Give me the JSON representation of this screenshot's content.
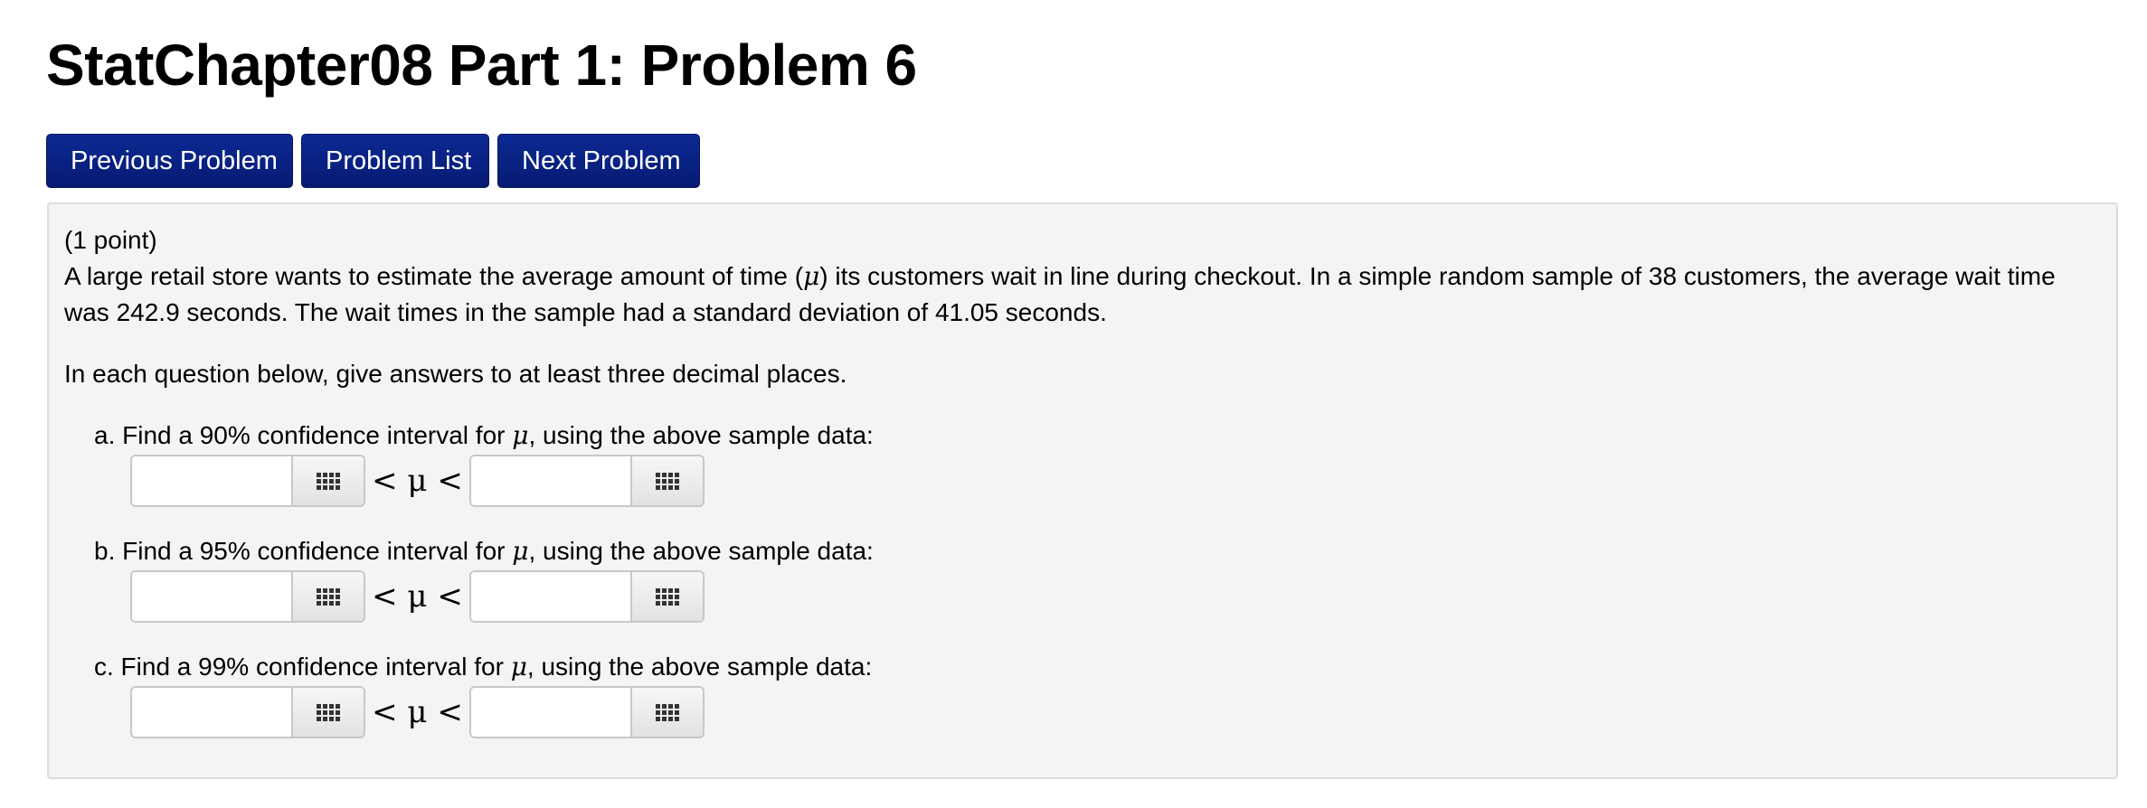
{
  "page": {
    "title": "StatChapter08 Part 1: Problem 6"
  },
  "nav": {
    "previous_label": "Previous Problem",
    "list_label": "Problem List",
    "next_label": "Next Problem"
  },
  "problem": {
    "points": "(1 point)",
    "intro_line1_before_mu": "A large retail store wants to estimate the average amount of time (",
    "mu": "μ",
    "intro_line1_after_mu": ") its customers wait in line during checkout. In a simple random sample of 38 customers, the average wait time",
    "intro_line2": "was 242.9 seconds. The wait times in the sample had a standard deviation of 41.05 seconds.",
    "instructions": "In each question below, give answers to at least three decimal places.",
    "questions": [
      {
        "label_before_mu": "a. Find a 90% confidence interval for ",
        "label_after_mu": ", using the above sample data:",
        "inequality": "< μ <",
        "lower_value": "",
        "upper_value": ""
      },
      {
        "label_before_mu": "b. Find a 95% confidence interval for ",
        "label_after_mu": ", using the above sample data:",
        "inequality": "< μ <",
        "lower_value": "",
        "upper_value": ""
      },
      {
        "label_before_mu": "c. Find a 99% confidence interval for ",
        "label_after_mu": ", using the above sample data:",
        "inequality": "< μ <",
        "lower_value": "",
        "upper_value": ""
      }
    ]
  },
  "icons": {
    "equation_editor": "keypad-grid-icon"
  },
  "colors": {
    "nav_button": "#0a2382",
    "panel_background": "#f4f4f4",
    "panel_border": "#dcdcdc"
  }
}
